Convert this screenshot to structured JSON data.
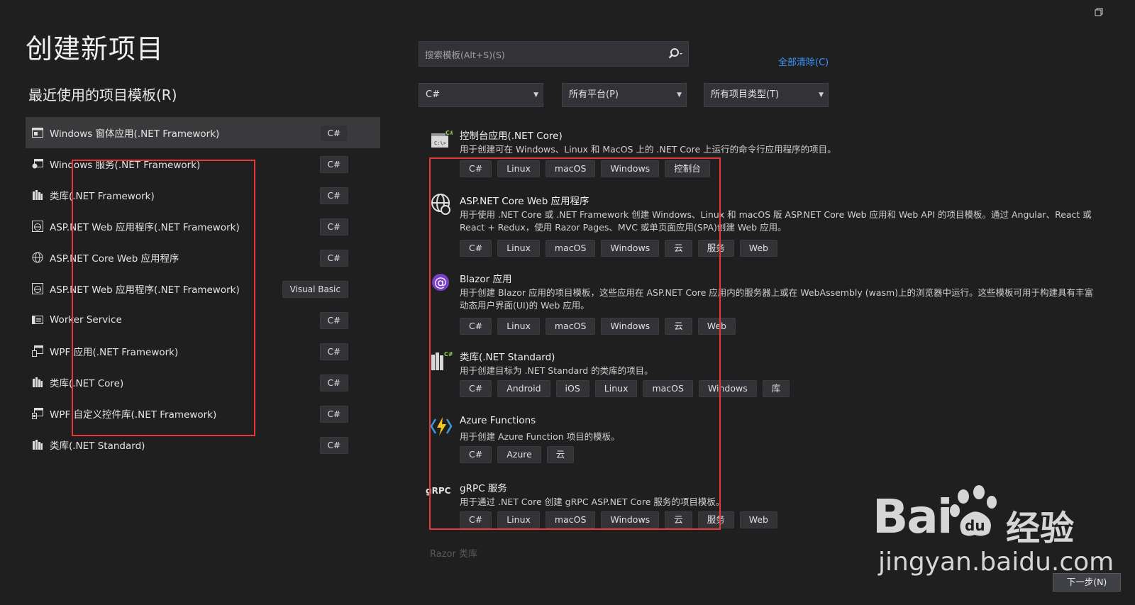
{
  "title": "创建新项目",
  "recent_title": "最近使用的项目模板(R)",
  "recent_items": [
    {
      "name": "Windows 窗体应用(.NET Framework)",
      "lang": "C#",
      "icon": "windows-forms-icon"
    },
    {
      "name": "Windows 服务(.NET Framework)",
      "lang": "C#",
      "icon": "windows-service-icon"
    },
    {
      "name": "类库(.NET Framework)",
      "lang": "C#",
      "icon": "class-library-icon"
    },
    {
      "name": "ASP.NET Web 应用程序(.NET Framework)",
      "lang": "C#",
      "icon": "aspnet-web-icon"
    },
    {
      "name": "ASP.NET Core Web 应用程序",
      "lang": "C#",
      "icon": "globe-icon"
    },
    {
      "name": "ASP.NET Web 应用程序(.NET Framework)",
      "lang": "Visual Basic",
      "icon": "aspnet-web-icon"
    },
    {
      "name": "Worker Service",
      "lang": "C#",
      "icon": "worker-service-icon"
    },
    {
      "name": "WPF 应用(.NET Framework)",
      "lang": "C#",
      "icon": "wpf-app-icon"
    },
    {
      "name": "类库(.NET Core)",
      "lang": "C#",
      "icon": "class-library-icon"
    },
    {
      "name": "WPF 自定义控件库(.NET Framework)",
      "lang": "C#",
      "icon": "wpf-control-library-icon"
    },
    {
      "name": "类库(.NET Standard)",
      "lang": "C#",
      "icon": "class-library-icon"
    }
  ],
  "search": {
    "placeholder": "搜索模板(Alt+S)(S)"
  },
  "clear_all": "全部清除(C)",
  "filters": {
    "language": "C#",
    "platform": "所有平台(P)",
    "project_type": "所有项目类型(T)"
  },
  "templates": [
    {
      "name": "控制台应用(.NET Core)",
      "desc": "用于创建可在 Windows、Linux 和 MacOS 上的 .NET Core 上运行的命令行应用程序的项目。",
      "tags": [
        "C#",
        "Linux",
        "macOS",
        "Windows",
        "控制台"
      ],
      "icon": "console-app-icon"
    },
    {
      "name": "ASP.NET Core Web 应用程序",
      "desc": "用于使用 .NET Core 或 .NET Framework 创建 Windows、Linux 和 macOS 版 ASP.NET Core Web 应用和 Web API 的项目模板。通过 Angular、React 或 React + Redux，使用 Razor Pages、MVC 或单页面应用(SPA)创建 Web 应用。",
      "tags": [
        "C#",
        "Linux",
        "macOS",
        "Windows",
        "云",
        "服务",
        "Web"
      ],
      "icon": "globe-icon"
    },
    {
      "name": "Blazor 应用",
      "desc": "用于创建 Blazor 应用的项目模板，这些应用在 ASP.NET Core 应用内的服务器上或在 WebAssembly (wasm)上的浏览器中运行。这些模板可用于构建具有丰富动态用户界面(UI)的 Web 应用。",
      "tags": [
        "C#",
        "Linux",
        "macOS",
        "Windows",
        "云",
        "Web"
      ],
      "icon": "blazor-icon"
    },
    {
      "name": "类库(.NET Standard)",
      "desc": "用于创建目标为 .NET Standard 的类库的项目。",
      "tags": [
        "C#",
        "Android",
        "iOS",
        "Linux",
        "macOS",
        "Windows",
        "库"
      ],
      "icon": "class-library-icon"
    },
    {
      "name": "Azure Functions",
      "desc": "用于创建 Azure Function 项目的模板。",
      "tags": [
        "C#",
        "Azure",
        "云"
      ],
      "icon": "azure-functions-icon"
    },
    {
      "name": "gRPC 服务",
      "desc": "用于通过 .NET Core 创建 gRPC ASP.NET Core 服务的项目模板。",
      "tags": [
        "C#",
        "Linux",
        "macOS",
        "Windows",
        "云",
        "服务",
        "Web"
      ],
      "icon": "grpc-icon",
      "icon_text": "gRPC"
    }
  ],
  "faded_item": "Razor 类库",
  "next_button": "下一步(N)",
  "watermark": {
    "bai": "Bai",
    "jingyan": "经验",
    "url": "jingyan.baidu.com"
  },
  "colors": {
    "background": "#1f1f1f",
    "link": "#3794ff",
    "highlight_box": "#e53a3a"
  }
}
